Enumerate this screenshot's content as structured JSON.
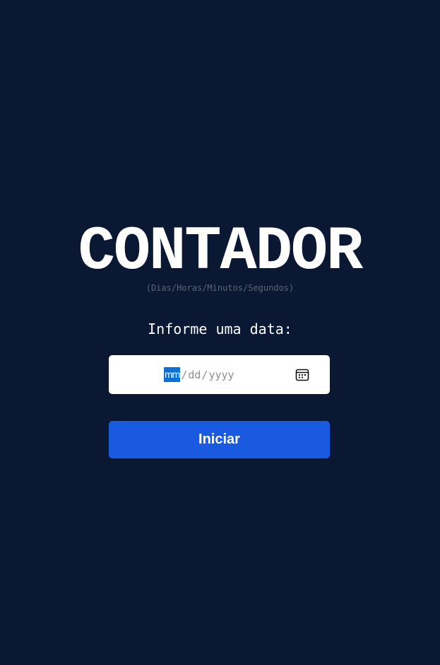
{
  "header": {
    "title": "CONTADOR",
    "subtitle": "(Dias/Horas/Minutos/Segundos)"
  },
  "form": {
    "prompt": "Informe uma data:",
    "date_input": {
      "month_placeholder": "mm",
      "separator": "/",
      "day_placeholder": "dd",
      "year_placeholder": "yyyy",
      "calendar_icon": "calendar-icon"
    },
    "submit_label": "Iniciar"
  },
  "colors": {
    "background": "#0b1833",
    "button": "#1a5ae0",
    "segment_highlight": "#0b71d6",
    "subtitle_text": "#5b6477"
  }
}
